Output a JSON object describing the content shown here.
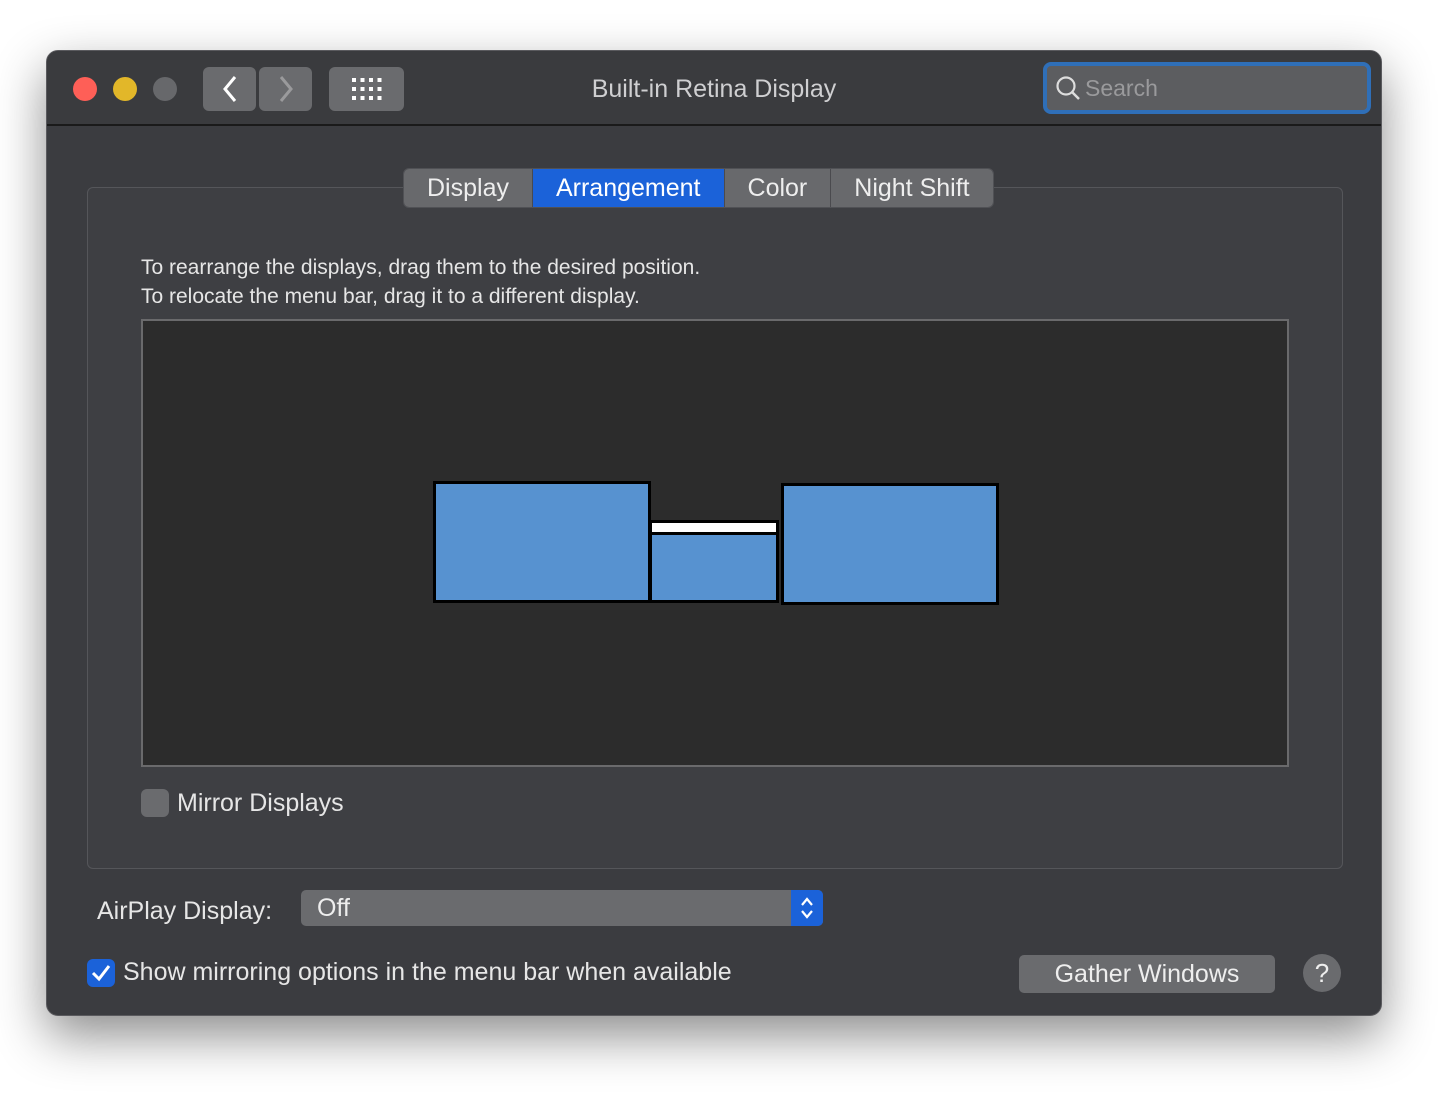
{
  "window": {
    "title": "Built-in Retina Display"
  },
  "search": {
    "placeholder": "Search"
  },
  "tabs": [
    {
      "label": "Display"
    },
    {
      "label": "Arrangement",
      "active": true
    },
    {
      "label": "Color"
    },
    {
      "label": "Night Shift"
    }
  ],
  "instructions": {
    "line1": "To rearrange the displays, drag them to the desired position.",
    "line2": "To relocate the menu bar, drag it to a different display."
  },
  "arrangement": {
    "displays": [
      {
        "id": "left",
        "menu_bar": false
      },
      {
        "id": "center",
        "menu_bar": true
      },
      {
        "id": "right",
        "menu_bar": false
      }
    ],
    "display_color": "#5792d0"
  },
  "mirror": {
    "label": "Mirror Displays",
    "checked": false
  },
  "airplay": {
    "label": "AirPlay Display:",
    "value": "Off"
  },
  "show_mirroring": {
    "label": "Show mirroring options in the menu bar when available",
    "checked": true
  },
  "buttons": {
    "gather": "Gather Windows",
    "help": "?"
  },
  "colors": {
    "accent": "#1b62d9",
    "close": "#fe5f57",
    "minimize": "#e2b729",
    "zoom_disabled": "#67686b"
  }
}
